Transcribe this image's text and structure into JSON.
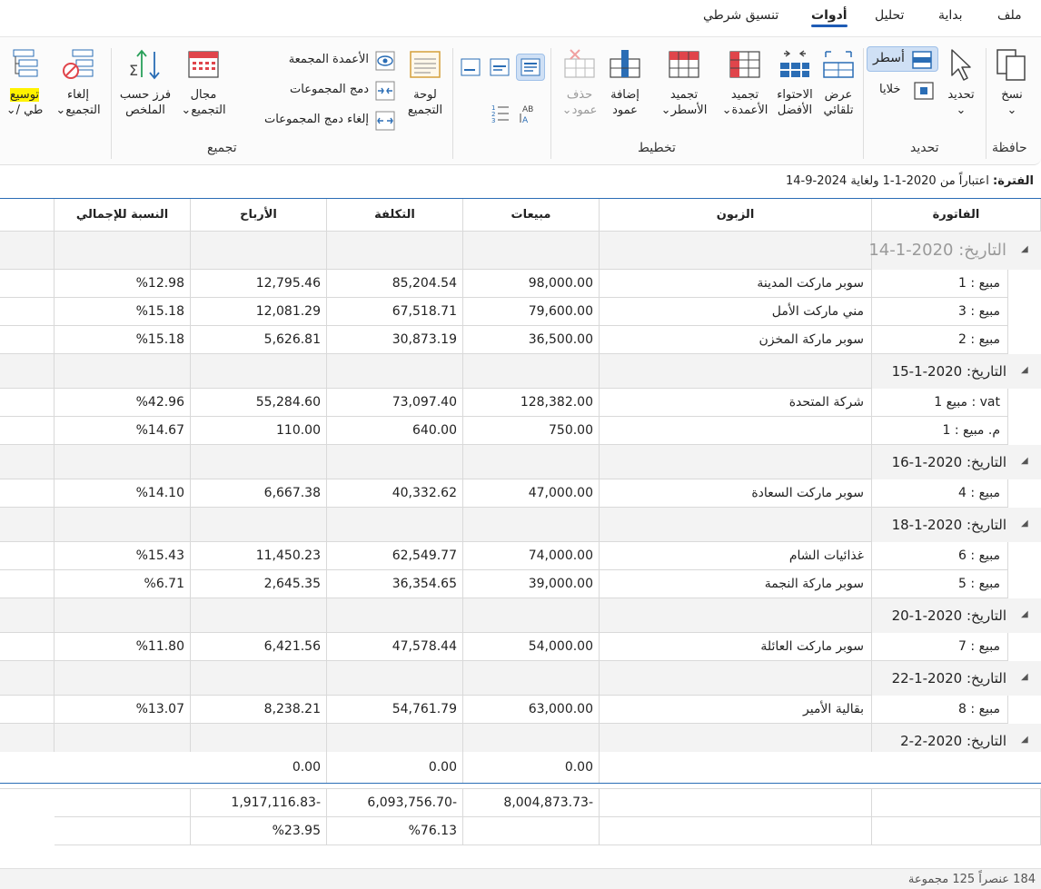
{
  "menu": {
    "tabs": [
      {
        "label": "ملف",
        "active": false
      },
      {
        "label": "بداية",
        "active": false
      },
      {
        "label": "تحليل",
        "active": false
      },
      {
        "label": "أدوات",
        "active": true
      },
      {
        "label": "تنسيق شرطي",
        "active": false
      }
    ]
  },
  "ribbon": {
    "clipboard": {
      "group": "حافظة",
      "copy": "نسخ"
    },
    "select": {
      "group": "تحديد",
      "select_btn": "تحديد",
      "rows": "أسطر",
      "cells": "خلايا"
    },
    "layout": {
      "group": "تخطيط",
      "auto_view_1": "عرض",
      "auto_view_2": "تلقائي",
      "best_fit_1": "الاحتواء",
      "best_fit_2": "الأفضل",
      "freeze_cols_1": "تجميد",
      "freeze_cols_2": "الأعمدة",
      "freeze_rows_1": "تجميد",
      "freeze_rows_2": "الأسطر",
      "add_col_1": "إضافة",
      "add_col_2": "عمود",
      "del_col_1": "حذف",
      "del_col_2": "عمود"
    },
    "grouping": {
      "group": "تجميع",
      "panel_1": "لوحة",
      "panel_2": "التجميع",
      "grouped_cols": "الأعمدة المجمعة",
      "merge_groups": "دمج المجموعات",
      "unmerge_groups": "إلغاء دمج المجموعات",
      "range_1": "مجال",
      "range_2": "التجميع",
      "sort_1": "فرز حسب",
      "sort_2": "الملخص",
      "cancel_1": "إلغاء",
      "cancel_2": "التجميع",
      "expand_1": "توسيع",
      "expand_2": "/ طي"
    }
  },
  "period": {
    "label": "الفترة:",
    "text": "اعتباراً من 2020-1-1 ولغاية 2024-9-14"
  },
  "grid": {
    "columns": [
      "الفاتورة",
      "الزبون",
      "مبيعات",
      "التكلفة",
      "الأرباح",
      "النسبة للإجمالي"
    ],
    "groups": [
      {
        "title": "التاريخ: 2020-1-14",
        "rows": [
          [
            "مبيع : 1",
            "سوبر ماركت المدينة",
            "98,000.00",
            "85,204.54",
            "12,795.46",
            "%12.98"
          ],
          [
            "مبيع : 3",
            "مني ماركت الأمل",
            "79,600.00",
            "67,518.71",
            "12,081.29",
            "%15.18"
          ],
          [
            "مبيع : 2",
            "سوبر ماركة المخزن",
            "36,500.00",
            "30,873.19",
            "5,626.81",
            "%15.18"
          ]
        ]
      },
      {
        "title": "التاريخ: 2020-1-15",
        "rows": [
          [
            "مبيع 1 : vat",
            "شركة المتحدة",
            "128,382.00",
            "73,097.40",
            "55,284.60",
            "%42.96"
          ],
          [
            "م. مبيع : 1",
            "",
            "750.00",
            "640.00",
            "110.00",
            "%14.67"
          ]
        ]
      },
      {
        "title": "التاريخ: 2020-1-16",
        "rows": [
          [
            "مبيع : 4",
            "سوبر ماركت السعادة",
            "47,000.00",
            "40,332.62",
            "6,667.38",
            "%14.10"
          ]
        ]
      },
      {
        "title": "التاريخ: 2020-1-18",
        "rows": [
          [
            "مبيع : 6",
            "غذائيات الشام",
            "74,000.00",
            "62,549.77",
            "11,450.23",
            "%15.43"
          ],
          [
            "مبيع : 5",
            "سوبر ماركة النجمة",
            "39,000.00",
            "36,354.65",
            "2,645.35",
            "%6.71"
          ]
        ]
      },
      {
        "title": "التاريخ: 2020-1-20",
        "rows": [
          [
            "مبيع : 7",
            "سوبر ماركت العائلة",
            "54,000.00",
            "47,578.44",
            "6,421.56",
            "%11.80"
          ]
        ]
      },
      {
        "title": "التاريخ: 2020-1-22",
        "rows": [
          [
            "مبيع : 8",
            "بقالية الأمير",
            "63,000.00",
            "54,761.79",
            "8,238.21",
            "%13.07"
          ]
        ]
      },
      {
        "title": "التاريخ: 2020-2-2",
        "rows": []
      }
    ],
    "group_totals": {
      "sales": "0.00",
      "cost": "0.00",
      "profit": "0.00"
    }
  },
  "summary": {
    "sales": "8,004,873.73-",
    "cost": "6,093,756.70-",
    "profit": "1,917,116.83-",
    "cost_pct": "%76.13",
    "profit_pct": "%23.95"
  },
  "status": {
    "text": "184 عنصراً 125 مجموعة"
  },
  "colors": {
    "accent": "#1e5bb5",
    "highlight": "#fff200"
  }
}
